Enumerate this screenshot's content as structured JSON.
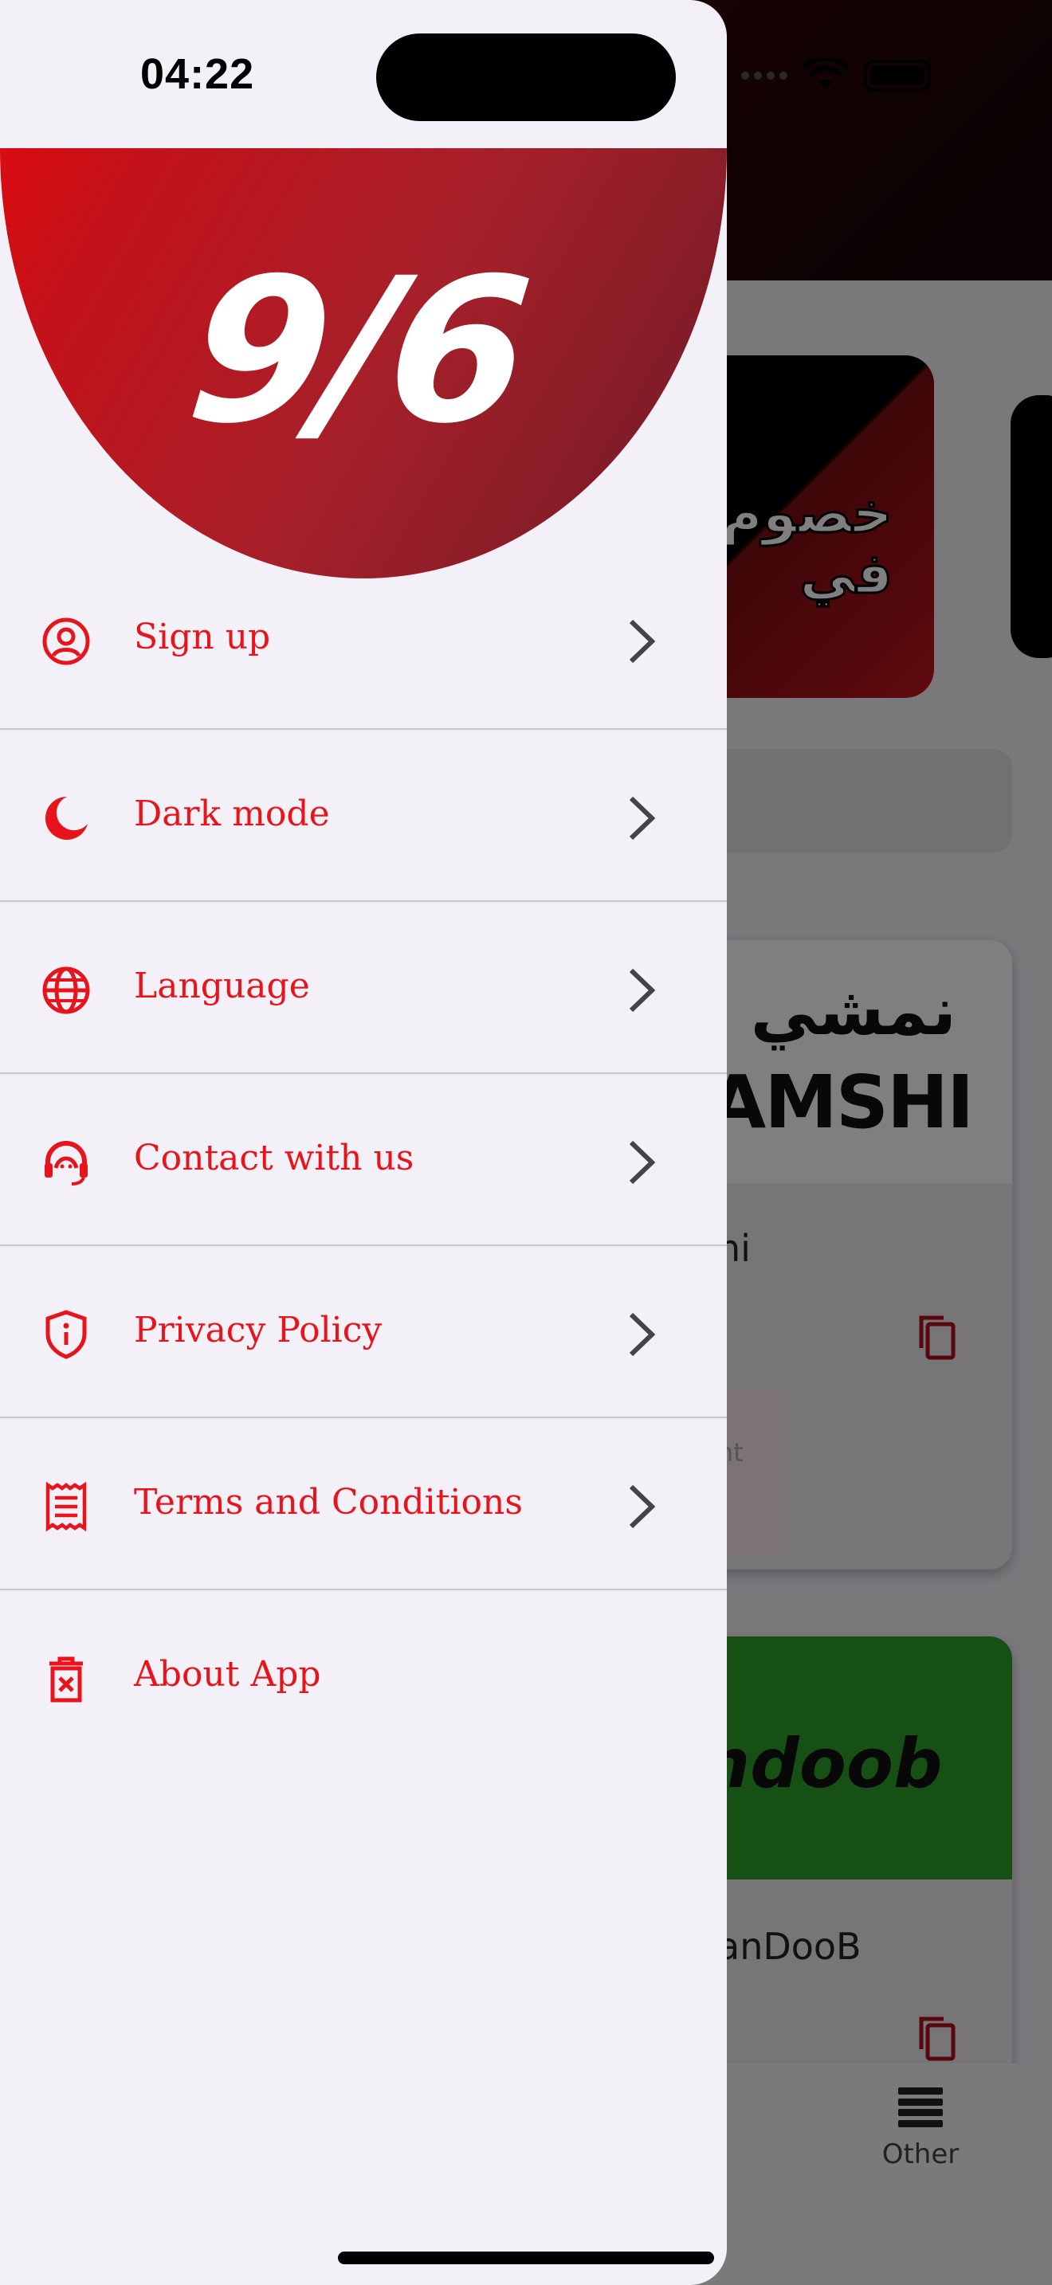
{
  "status_bar": {
    "time": "04:22"
  },
  "brand": {
    "logo_text": "9/6",
    "accent": "#e8141c"
  },
  "menu": {
    "items": [
      {
        "label": "Sign up",
        "icon": "user-circle-icon",
        "chevron": true
      },
      {
        "label": "Dark mode",
        "icon": "moon-icon",
        "chevron": true
      },
      {
        "label": "Language",
        "icon": "globe-icon",
        "chevron": true
      },
      {
        "label": "Contact with us",
        "icon": "headset-icon",
        "chevron": true
      },
      {
        "label": "Privacy Policy",
        "icon": "shield-info-icon",
        "chevron": true
      },
      {
        "label": "Terms and Conditions",
        "icon": "receipt-icon",
        "chevron": true
      },
      {
        "label": "About App",
        "icon": "trash-x-icon",
        "chevron": false
      }
    ]
  },
  "background_app": {
    "banner_text": "خصوم في",
    "stores": [
      {
        "logo_ar": "نمشي",
        "logo_en": "AMSHI",
        "name": "hi",
        "discount_text": "nt"
      },
      {
        "logo_en": "ndoob",
        "name": "anDooB"
      }
    ],
    "tabbar": {
      "other_label": "Other"
    }
  }
}
